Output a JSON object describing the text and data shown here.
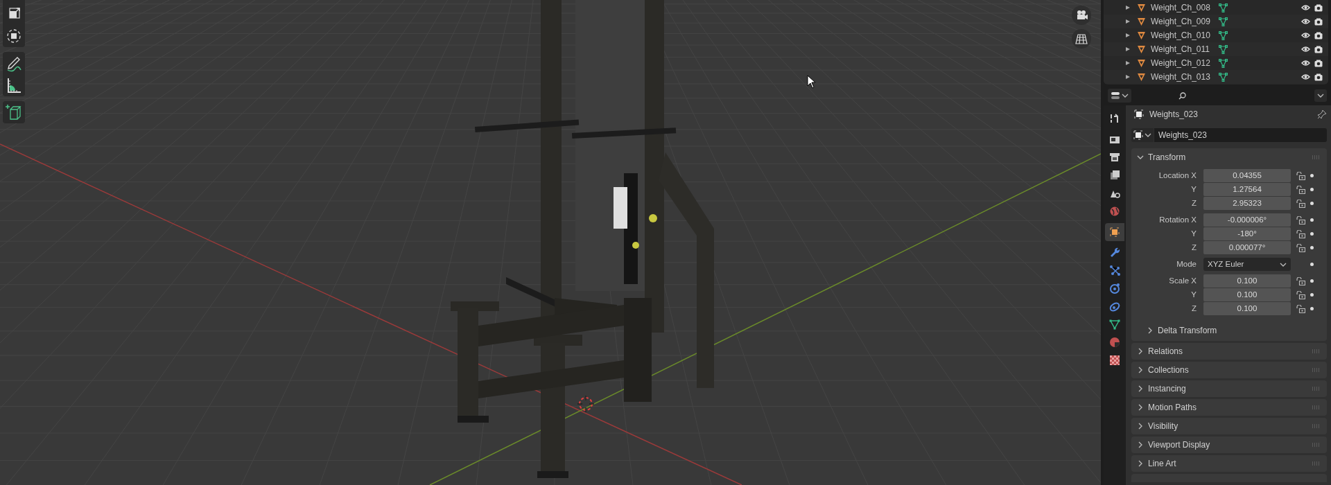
{
  "outliner": {
    "rows": [
      {
        "name": "Weight_Ch_008"
      },
      {
        "name": "Weight_Ch_009"
      },
      {
        "name": "Weight_Ch_010"
      },
      {
        "name": "Weight_Ch_011"
      },
      {
        "name": "Weight_Ch_012"
      },
      {
        "name": "Weight_Ch_013"
      }
    ]
  },
  "properties": {
    "tabs": [
      {
        "kind": "tool",
        "selected": false
      },
      {
        "kind": "render",
        "selected": false
      },
      {
        "kind": "output",
        "selected": false
      },
      {
        "kind": "view_layer",
        "selected": false
      },
      {
        "kind": "scene",
        "selected": false
      },
      {
        "kind": "world",
        "selected": false
      },
      {
        "kind": "object",
        "selected": true
      },
      {
        "kind": "modifiers",
        "selected": false
      },
      {
        "kind": "particles",
        "selected": false
      },
      {
        "kind": "physics",
        "selected": false
      },
      {
        "kind": "constraints",
        "selected": false
      },
      {
        "kind": "data",
        "selected": false
      },
      {
        "kind": "material",
        "selected": false
      },
      {
        "kind": "texture",
        "selected": false
      }
    ],
    "object_name": "Weights_023",
    "datablock_name": "Weights_023",
    "transform": {
      "title": "Transform",
      "expanded": true,
      "groups": [
        {
          "rows": [
            {
              "kind": "number",
              "label": "Location X",
              "value": "0.04355"
            },
            {
              "kind": "number",
              "label": "Y",
              "value": "1.27564"
            },
            {
              "kind": "number",
              "label": "Z",
              "value": "2.95323"
            }
          ]
        },
        {
          "rows": [
            {
              "kind": "number",
              "label": "Rotation X",
              "value": "-0.000006°"
            },
            {
              "kind": "number",
              "label": "Y",
              "value": "-180°"
            },
            {
              "kind": "number",
              "label": "Z",
              "value": "0.000077°"
            }
          ]
        },
        {
          "rows": [
            {
              "kind": "dropdown",
              "label": "Mode",
              "value": "XYZ Euler"
            }
          ]
        },
        {
          "rows": [
            {
              "kind": "number",
              "label": "Scale X",
              "value": "0.100"
            },
            {
              "kind": "number",
              "label": "Y",
              "value": "0.100"
            },
            {
              "kind": "number",
              "label": "Z",
              "value": "0.100"
            }
          ]
        }
      ],
      "subpanel": {
        "title": "Delta Transform",
        "expanded": false
      }
    },
    "panels": [
      {
        "title": "Relations",
        "expanded": false
      },
      {
        "title": "Collections",
        "expanded": false
      },
      {
        "title": "Instancing",
        "expanded": false
      },
      {
        "title": "Motion Paths",
        "expanded": false
      },
      {
        "title": "Visibility",
        "expanded": false
      },
      {
        "title": "Viewport Display",
        "expanded": false
      },
      {
        "title": "Line Art",
        "expanded": false
      }
    ]
  }
}
